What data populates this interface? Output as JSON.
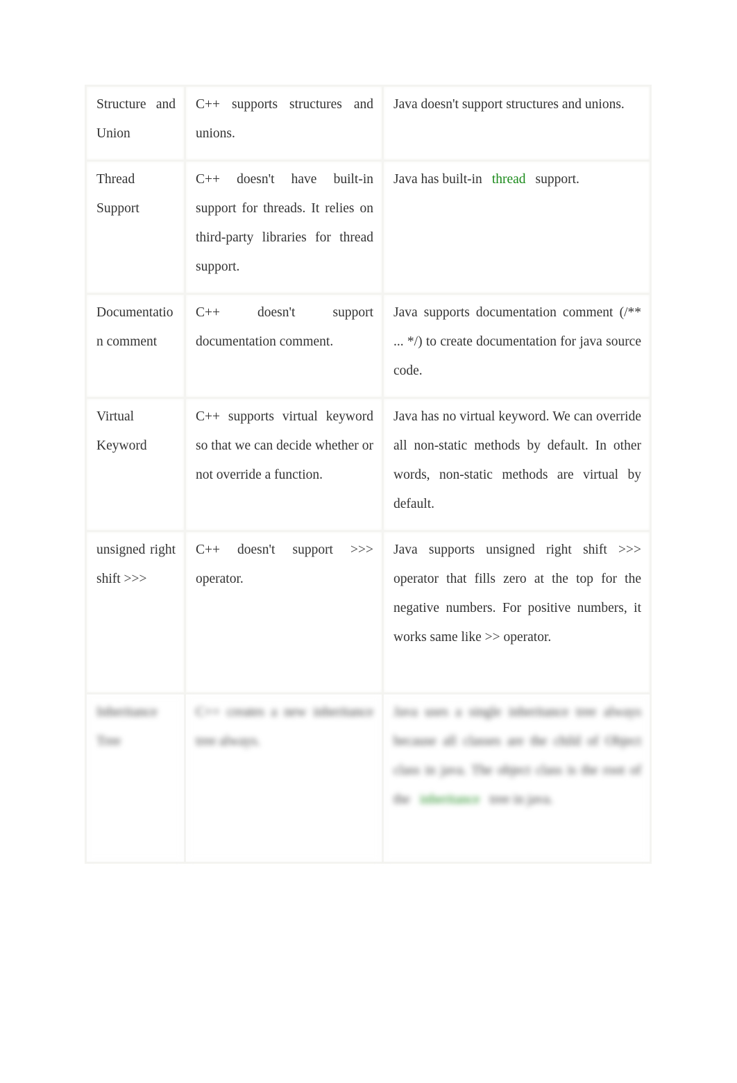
{
  "rows": [
    {
      "feature": "Structure and Union",
      "cpp": "C++ supports structures and unions.",
      "java": "Java doesn't support structures and unions."
    },
    {
      "feature": "Thread Support",
      "cpp": "C++ doesn't have built-in support for threads. It relies on third-party libraries for thread support.",
      "java_before": "Java has built-in",
      "java_link": "thread",
      "java_after": "support."
    },
    {
      "feature": "Documentation comment",
      "cpp": "C++ doesn't support documentation comment.",
      "java": "Java supports documentation comment (/** ... */) to create documentation for java source code."
    },
    {
      "feature": "Virtual Keyword",
      "cpp": "C++ supports virtual keyword so that we can decide whether or not override a function.",
      "java": "Java has no virtual keyword. We can override all non-static methods by default. In other words, non-static methods are virtual by default."
    },
    {
      "feature": "unsigned right shift >>>",
      "cpp": "C++ doesn't support >>> operator.",
      "java": "Java supports unsigned right shift >>> operator that fills zero at the top for the negative numbers. For positive numbers, it works same like >> operator."
    },
    {
      "feature": "Inheritance Tree",
      "cpp": "C++ creates a new inheritance tree always.",
      "java_before": "Java uses a single inheritance tree always because all classes are the child of Object class in java. The object class is the root of the",
      "java_link": "inheritance",
      "java_after": "tree in java."
    }
  ],
  "colors": {
    "link": "#1a8a1a",
    "text": "#333333"
  }
}
